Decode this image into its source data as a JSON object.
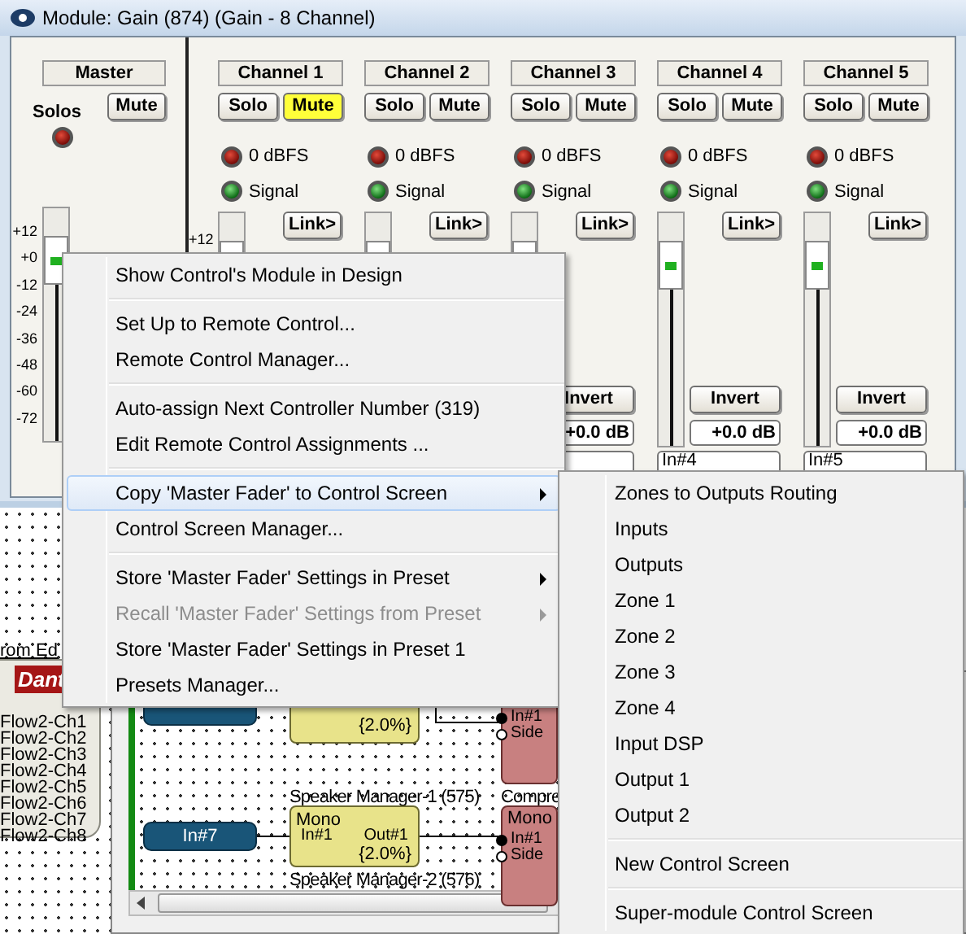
{
  "window": {
    "title": "Module: Gain (874) (Gain - 8 Channel)"
  },
  "master": {
    "label": "Master",
    "solos_label": "Solos",
    "mute": {
      "label": "Mute",
      "on": false
    },
    "scale": [
      "+12",
      "+0",
      "-12",
      "-24",
      "-36",
      "-48",
      "-60",
      "-72"
    ],
    "fader": {
      "level": 0.88
    }
  },
  "channels": [
    {
      "label": "Channel 1",
      "solo": {
        "label": "Solo",
        "on": false
      },
      "mute": {
        "label": "Mute",
        "on": true
      },
      "clip_label": "0 dBFS",
      "signal_label": "Signal",
      "link": "Link>",
      "scale_top": "+12",
      "fader": {
        "level": 0.88
      }
    },
    {
      "label": "Channel 2",
      "solo": {
        "label": "Solo",
        "on": false
      },
      "mute": {
        "label": "Mute",
        "on": false
      },
      "clip_label": "0 dBFS",
      "signal_label": "Signal",
      "link": "Link>",
      "fader": {
        "level": 0.88
      }
    },
    {
      "label": "Channel 3",
      "solo": {
        "label": "Solo",
        "on": false
      },
      "mute": {
        "label": "Mute",
        "on": false
      },
      "clip_label": "0 dBFS",
      "signal_label": "Signal",
      "link": "Link>",
      "fader": {
        "level": 0.88
      },
      "invert": "Invert",
      "gain": "+0.0 dB"
    },
    {
      "label": "Channel 4",
      "solo": {
        "label": "Solo",
        "on": false
      },
      "mute": {
        "label": "Mute",
        "on": false
      },
      "clip_label": "0 dBFS",
      "signal_label": "Signal",
      "link": "Link>",
      "fader": {
        "level": 0.88
      },
      "invert": "Invert",
      "gain": "+0.0 dB",
      "name": "In#4"
    },
    {
      "label": "Channel 5",
      "solo": {
        "label": "Solo",
        "on": false
      },
      "mute": {
        "label": "Mute",
        "on": false
      },
      "clip_label": "0 dBFS",
      "signal_label": "Signal",
      "link": "Link>",
      "fader": {
        "level": 0.88
      },
      "invert": "Invert",
      "gain": "+0.0 dB",
      "name": "In#5"
    }
  ],
  "design": {
    "source_panel": {
      "heading": "rom Ed",
      "logo": "Dant",
      "channels": [
        "Flow2-Ch1",
        "Flow2-Ch2",
        "Flow2-Ch3",
        "Flow2-Ch4",
        "Flow2-Ch5",
        "Flow2-Ch6",
        "Flow2-Ch7",
        "Flow2-Ch8"
      ]
    },
    "blocks": [
      {
        "kind": "input"
      },
      {
        "kind": "processor",
        "value": "{2.0%}"
      },
      {
        "kind": "compressor",
        "ports": [
          {
            "label": "In#1",
            "connected": true
          },
          {
            "label": "Side",
            "connected": false
          }
        ]
      },
      {
        "kind": "caption",
        "text": "Speaker Manager-1 (575)"
      },
      {
        "kind": "caption",
        "text": "Compre"
      },
      {
        "kind": "input",
        "label": "In#7"
      },
      {
        "kind": "processor",
        "label": "Mono",
        "port_in": "In#1",
        "port_out": "Out#1",
        "value": "{2.0%}"
      },
      {
        "kind": "compressor",
        "label": "Mono",
        "ports": [
          {
            "label": "In#1",
            "connected": true
          },
          {
            "label": "Side",
            "connected": false
          }
        ]
      },
      {
        "kind": "caption",
        "text": "Speaker Manager-2 (576)"
      }
    ]
  },
  "context_menu": {
    "items": [
      {
        "kind": "item",
        "label": "Show Control's Module in Design",
        "selected": false,
        "disabled": false,
        "has_submenu": false
      },
      {
        "kind": "separator"
      },
      {
        "kind": "item",
        "label": "Set Up to Remote Control...",
        "selected": false,
        "disabled": false,
        "has_submenu": false
      },
      {
        "kind": "item",
        "label": "Remote Control Manager...",
        "selected": false,
        "disabled": false,
        "has_submenu": false
      },
      {
        "kind": "separator"
      },
      {
        "kind": "item",
        "label": "Auto-assign Next Controller Number (319)",
        "selected": false,
        "disabled": false,
        "has_submenu": false
      },
      {
        "kind": "item",
        "label": "Edit Remote Control Assignments ...",
        "selected": false,
        "disabled": false,
        "has_submenu": false
      },
      {
        "kind": "separator"
      },
      {
        "kind": "item",
        "label": "Copy 'Master Fader' to Control Screen",
        "selected": true,
        "disabled": false,
        "has_submenu": true
      },
      {
        "kind": "item",
        "label": "Control Screen Manager...",
        "selected": false,
        "disabled": false,
        "has_submenu": false
      },
      {
        "kind": "separator"
      },
      {
        "kind": "item",
        "label": "Store 'Master Fader' Settings in Preset",
        "selected": false,
        "disabled": false,
        "has_submenu": true
      },
      {
        "kind": "item",
        "label": "Recall 'Master Fader' Settings from Preset",
        "selected": false,
        "disabled": true,
        "has_submenu": true
      },
      {
        "kind": "item",
        "label": "Store 'Master Fader' Settings in Preset 1",
        "selected": false,
        "disabled": false,
        "has_submenu": false
      },
      {
        "kind": "item",
        "label": "Presets Manager...",
        "selected": false,
        "disabled": false,
        "has_submenu": false
      }
    ]
  },
  "submenu": {
    "items": [
      {
        "kind": "item",
        "label": "Zones to Outputs Routing",
        "selected": false
      },
      {
        "kind": "item",
        "label": "Inputs",
        "selected": false
      },
      {
        "kind": "item",
        "label": "Outputs",
        "selected": false
      },
      {
        "kind": "item",
        "label": "Zone 1",
        "selected": false
      },
      {
        "kind": "item",
        "label": "Zone 2",
        "selected": false
      },
      {
        "kind": "item",
        "label": "Zone 3",
        "selected": false
      },
      {
        "kind": "item",
        "label": "Zone 4",
        "selected": false
      },
      {
        "kind": "item",
        "label": "Input DSP",
        "selected": false
      },
      {
        "kind": "item",
        "label": "Output 1",
        "selected": false
      },
      {
        "kind": "item",
        "label": "Output 2",
        "selected": false
      },
      {
        "kind": "separator"
      },
      {
        "kind": "item",
        "label": "New Control Screen",
        "selected": false
      },
      {
        "kind": "separator"
      },
      {
        "kind": "item",
        "label": "Super-module Control Screen",
        "selected": false
      }
    ]
  }
}
